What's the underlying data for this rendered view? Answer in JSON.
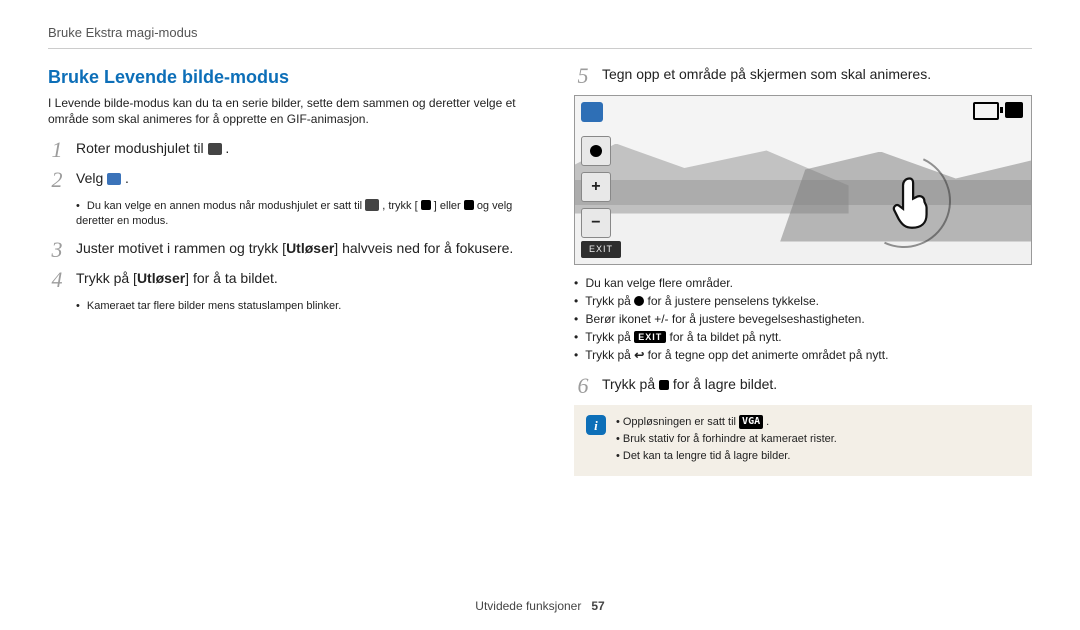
{
  "breadcrumb": "Bruke Ekstra magi-modus",
  "section_title": "Bruke Levende bilde-modus",
  "intro": "I Levende bilde-modus kan du ta en serie bilder, sette dem sammen og deretter velge et område som skal animeres for å opprette en GIF-animasjon.",
  "steps": {
    "s1": {
      "num": "1",
      "text_a": "Roter modushjulet til ",
      "text_b": "."
    },
    "s2": {
      "num": "2",
      "text_a": "Velg ",
      "text_b": "."
    },
    "s2_sub": {
      "a": "Du kan velge en annen modus når modushjulet er satt til ",
      "b": ", trykk [",
      "c": "] eller ",
      "d": " og velg deretter en modus."
    },
    "s3": {
      "num": "3",
      "text_a": "Juster motivet i rammen og trykk [",
      "text_bold": "Utløser",
      "text_b": "] halvveis ned for å fokusere."
    },
    "s4": {
      "num": "4",
      "text_a": "Trykk på [",
      "text_bold": "Utløser",
      "text_b": "] for å ta bildet."
    },
    "s4_sub": "Kameraet tar flere bilder mens statuslampen blinker.",
    "s5": {
      "num": "5",
      "text": "Tegn opp et område på skjermen som skal animeres."
    },
    "s6": {
      "num": "6",
      "text_a": "Trykk på ",
      "text_b": " for å lagre bildet."
    }
  },
  "tips": {
    "t1": "Du kan velge flere områder.",
    "t2_a": "Trykk på ",
    "t2_b": " for å justere penselens tykkelse.",
    "t3": "Berør ikonet +/- for å justere bevegelseshastigheten.",
    "t4_a": "Trykk på ",
    "t4_exit": "EXIT",
    "t4_b": " for å ta bildet på nytt.",
    "t5_a": "Trykk på ",
    "t5_b": " for å tegne opp det animerte området på nytt."
  },
  "notes": {
    "n1_a": "Oppløsningen er satt til ",
    "n1_vga": "VGA",
    "n1_b": ".",
    "n2": "Bruk stativ for å forhindre at kameraet rister.",
    "n3": "Det kan ta lengre tid å lagre bilder."
  },
  "camera": {
    "plus": "+",
    "minus": "−",
    "exit": "EXIT"
  },
  "footer": {
    "section": "Utvidede funksjoner",
    "page": "57"
  }
}
